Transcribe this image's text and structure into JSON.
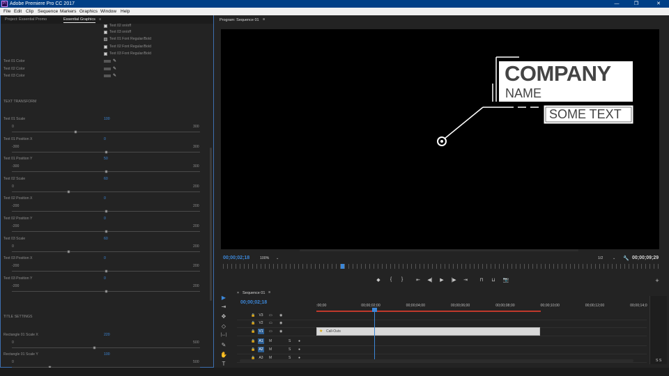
{
  "app": {
    "title": "Adobe Premiere Pro CC 2017",
    "logo_text": "Pr"
  },
  "menu": [
    "File",
    "Edit",
    "Clip",
    "Sequence",
    "Markers",
    "Graphics",
    "Window",
    "Help"
  ],
  "left_panel": {
    "tabs": [
      "Project: Essential Promo",
      "Essential Graphics"
    ],
    "tab_menu_icon": "≡",
    "checkboxes": [
      {
        "label": "Text 02 on/off",
        "checked": true
      },
      {
        "label": "Text 03 on/off",
        "checked": true
      },
      {
        "label": "Text 01 Font Regular/Bold",
        "checked": false
      },
      {
        "label": "Text 02 Font Regular/Bold",
        "checked": true
      },
      {
        "label": "Text 03 Font Regular/Bold",
        "checked": true
      }
    ],
    "colors": [
      "Text 01 Color",
      "Text 02 Color",
      "Text 03 Color"
    ],
    "section_transform": "TEXT TRANSFORM",
    "sliders": [
      {
        "label": "Text 01 Scale",
        "value": "100",
        "min": "0",
        "max": "300",
        "level": 0.34
      },
      {
        "label": "Text 01 Position X",
        "value": "0",
        "min": "-300",
        "max": "300",
        "level": 0.5
      },
      {
        "label": "Text 01 Position Y",
        "value": "50",
        "min": "-300",
        "max": "300",
        "level": 0.5
      },
      {
        "label": "Text 02 Scale",
        "value": "60",
        "min": "0",
        "max": "200",
        "level": 0.3
      },
      {
        "label": "Text 02 Position X",
        "value": "0",
        "min": "-200",
        "max": "200",
        "level": 0.5
      },
      {
        "label": "Text 02 Position Y",
        "value": "0",
        "min": "-200",
        "max": "200",
        "level": 0.5
      },
      {
        "label": "Text 03 Scale",
        "value": "60",
        "min": "0",
        "max": "200",
        "level": 0.3
      },
      {
        "label": "Text 03 Position X",
        "value": "0",
        "min": "-200",
        "max": "200",
        "level": 0.5
      },
      {
        "label": "Text 03 Position Y",
        "value": "0",
        "min": "-200",
        "max": "200",
        "level": 0.5
      }
    ],
    "section_title": "TITLE SETTINGS",
    "title_sliders": [
      {
        "label": "Rectangle 01 Scale X",
        "value": "220",
        "min": "0",
        "max": "500",
        "level": 0.44
      },
      {
        "label": "Rectangle 01 Scale Y",
        "value": "100",
        "min": "0",
        "max": "500",
        "level": 0.2
      }
    ]
  },
  "program": {
    "tab": "Program: Sequence 01",
    "tab_menu_icon": "≡",
    "title_text": {
      "line1": "COMPANY",
      "line2": "NAME",
      "line3": "SOME TEXT"
    },
    "timecode_current": "00;00;02;18",
    "zoom": "100%",
    "resolution": "1/2",
    "timecode_duration": "00;00;09;29",
    "playhead_progress": 0.27,
    "controls": [
      "◆",
      "{",
      "}",
      "⇤",
      "◀|",
      "▶",
      "|▶",
      "⇥",
      "⊓",
      "⊔",
      "📷",
      "+"
    ]
  },
  "timeline": {
    "tab": "Sequence 01",
    "close_icon": "×",
    "tab_menu_icon": "≡",
    "timecode": "00;00;02;18",
    "ruler_labels": [
      ":00;00",
      "00;00;02;00",
      "00;00;04;00",
      "00;00;06;00",
      "00;00;08;00",
      "00;00;10;00",
      "00;00;12;00",
      "00;00;14;0"
    ],
    "tracks": [
      {
        "name": "V3"
      },
      {
        "name": "V2"
      },
      {
        "name": "V1"
      },
      {
        "name": "A1"
      },
      {
        "name": "A2"
      },
      {
        "name": "A3"
      }
    ],
    "clip_label": "Call-Outs",
    "meter_label": "S S",
    "tool_icons": [
      "▶",
      "⇥",
      "✥",
      "◇",
      "|↔|",
      "✎",
      "✋",
      "T"
    ]
  }
}
